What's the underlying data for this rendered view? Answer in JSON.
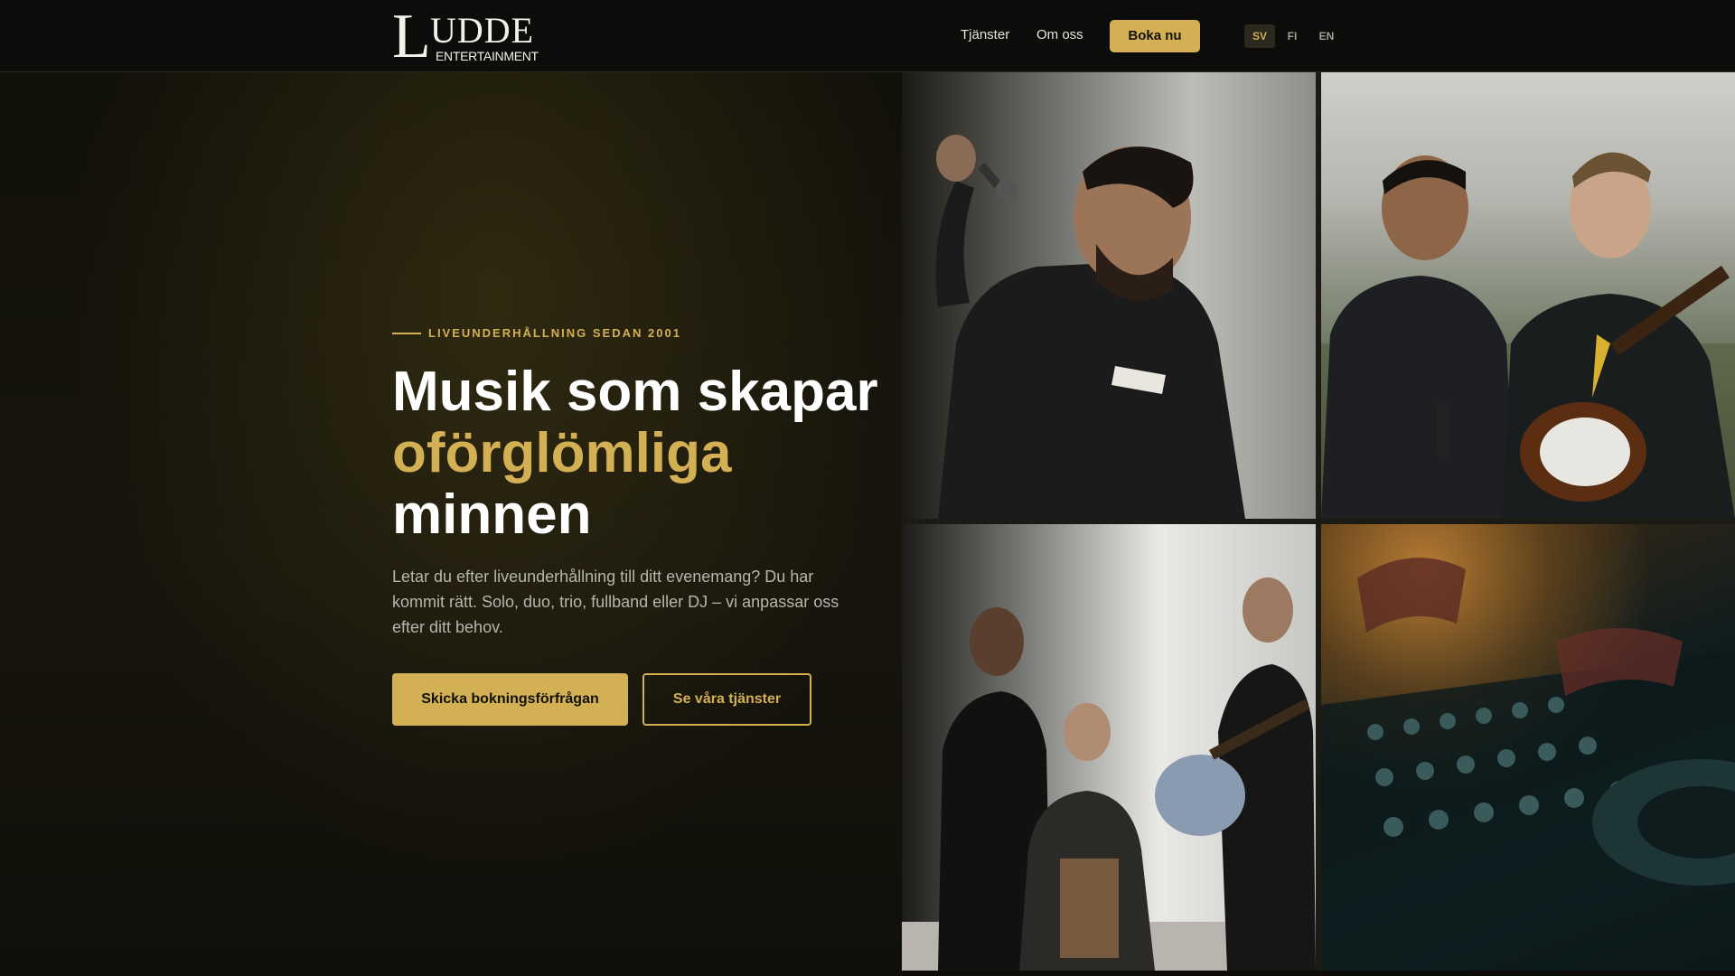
{
  "brand": {
    "logo_letter": "L",
    "logo_name": "UDDE",
    "logo_sub": "ENTERTAINMENT"
  },
  "nav": {
    "items": [
      {
        "label": "Tjänster"
      },
      {
        "label": "Om oss"
      }
    ],
    "cta_label": "Boka nu"
  },
  "languages": [
    {
      "code": "SV",
      "active": true
    },
    {
      "code": "FI",
      "active": false
    },
    {
      "code": "EN",
      "active": false
    }
  ],
  "hero": {
    "eyebrow": "LIVEUNDERHÅLLNING SEDAN 2001",
    "headline_line1": "Musik som skapar",
    "headline_highlight": "oförglömliga",
    "headline_line3": "minnen",
    "lead": "Letar du efter liveunderhållning till ditt evenemang? Du har kommit rätt. Solo, duo, trio, fullband eller DJ – vi anpassar oss efter ditt behov.",
    "primary_button": "Skicka bokningsförfrågan",
    "secondary_button": "Se våra tjänster"
  },
  "photos": [
    {
      "subject": "singer-with-microphone"
    },
    {
      "subject": "two-musicians-with-guitar"
    },
    {
      "subject": "acoustic-trio-on-pier"
    },
    {
      "subject": "dj-mixer-console"
    }
  ],
  "colors": {
    "accent": "#d4b055",
    "background": "#0f0e0a",
    "header": "#0c0c0b",
    "text": "#ffffff",
    "muted_text": "#b8b5ad"
  }
}
